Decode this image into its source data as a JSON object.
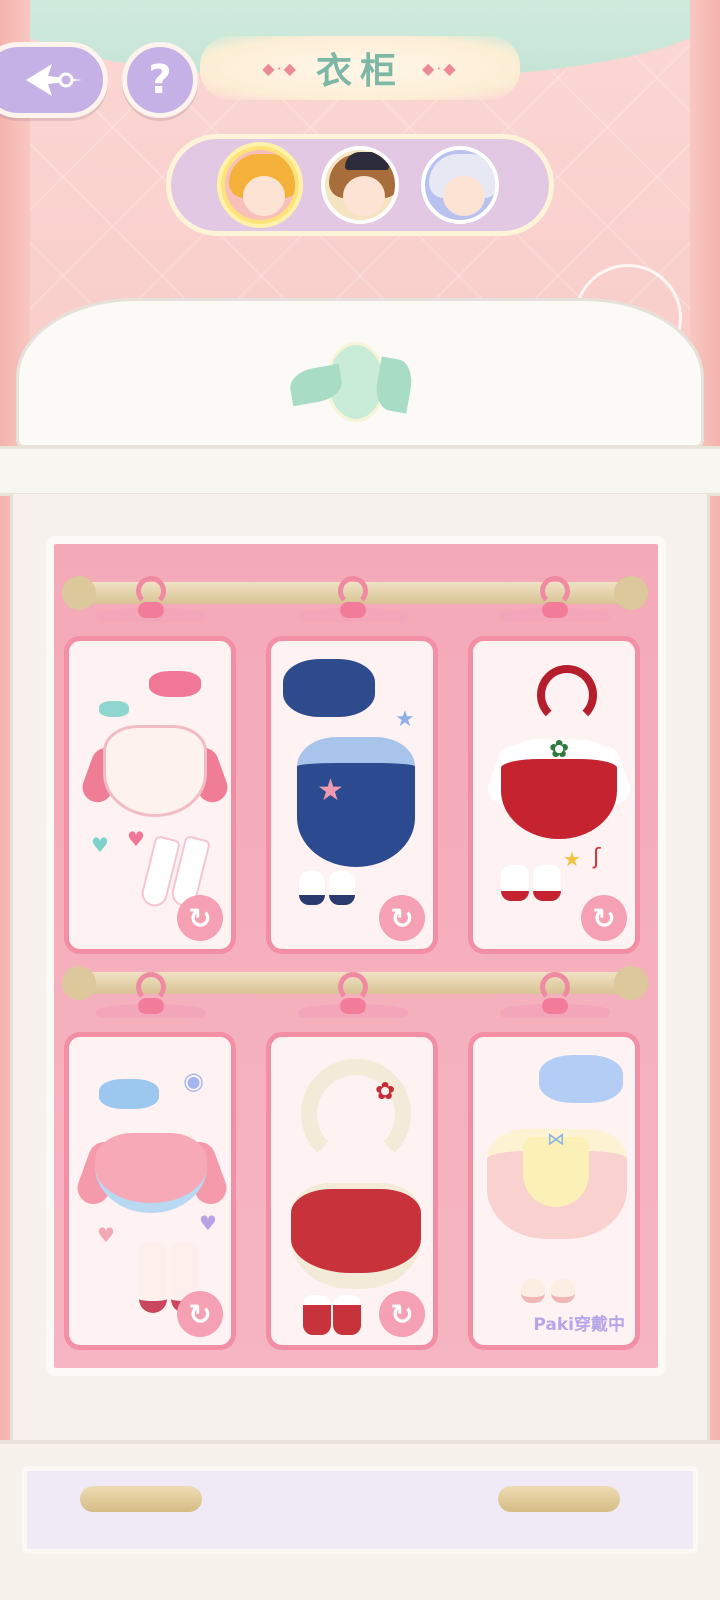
{
  "header": {
    "title": "衣柜",
    "help_symbol": "?",
    "characters": [
      {
        "name": "character-1",
        "selected": true
      },
      {
        "name": "character-2",
        "selected": false
      },
      {
        "name": "character-3",
        "selected": false
      }
    ]
  },
  "wardrobe": {
    "outfits": [
      {
        "id": "pink-sailor-dress",
        "status": "",
        "action": "↻"
      },
      {
        "id": "navy-star-dress",
        "status": "",
        "action": "↻"
      },
      {
        "id": "red-christmas-dress",
        "status": "",
        "action": "↻"
      },
      {
        "id": "pink-sweater-outfit",
        "status": "",
        "action": "↻"
      },
      {
        "id": "red-winter-dress",
        "status": "",
        "action": "↻"
      },
      {
        "id": "cream-apron-dress",
        "status": "Paki穿戴中",
        "action": ""
      }
    ]
  },
  "colors": {
    "accent_purple": "#c6b1e6",
    "card_border": "#f38fa5",
    "title_green": "#7fb7a6",
    "wearing_label": "#b6a6e8"
  }
}
